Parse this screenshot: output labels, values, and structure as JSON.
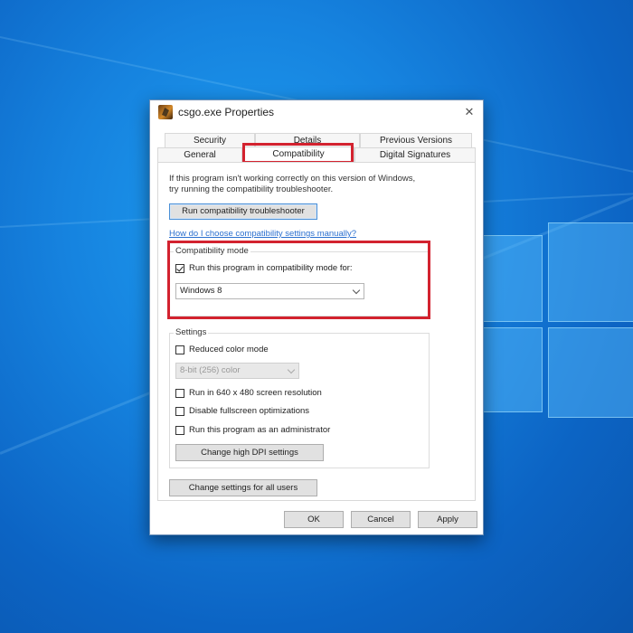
{
  "window": {
    "title": "csgo.exe Properties",
    "close_glyph": "✕",
    "app_icon": "csgo-app-icon"
  },
  "tabs": {
    "row_top": [
      "Security",
      "Details",
      "Previous Versions"
    ],
    "row_bottom": [
      "General",
      "Compatibility",
      "Digital Signatures"
    ],
    "active": "Compatibility"
  },
  "intro": {
    "text": "If this program isn't working correctly on this version of Windows,\ntry running the compatibility troubleshooter."
  },
  "troubleshooter_button": "Run compatibility troubleshooter",
  "manual_link": "How do I choose compatibility settings manually?",
  "compat_mode": {
    "group_label": "Compatibility mode",
    "checkbox_label": "Run this program in compatibility mode for:",
    "checked": true,
    "selected_os": "Windows 8"
  },
  "settings": {
    "group_label": "Settings",
    "reduced_color": {
      "label": "Reduced color mode",
      "checked": false
    },
    "color_select": "8-bit (256) color",
    "resolution": {
      "label": "Run in 640 x 480 screen resolution",
      "checked": false
    },
    "fullscreen_opt": {
      "label": "Disable fullscreen optimizations",
      "checked": false
    },
    "admin": {
      "label": "Run this program as an administrator",
      "checked": false
    },
    "dpi_button": "Change high DPI settings"
  },
  "all_users_button": "Change settings for all users",
  "footer": {
    "ok": "OK",
    "cancel": "Cancel",
    "apply": "Apply"
  },
  "colors": {
    "highlight": "#d3222f",
    "link": "#2a6fcf",
    "desktop": "#1683df"
  }
}
